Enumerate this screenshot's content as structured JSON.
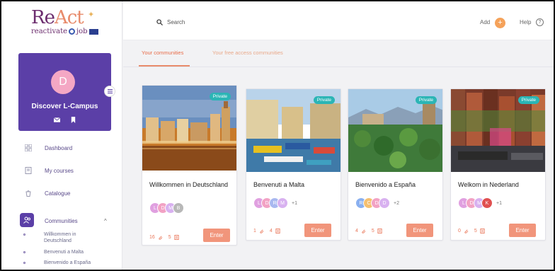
{
  "brand": {
    "logo_main": "Re",
    "logo_act": "Act",
    "logo_sub_pre": "reactivate",
    "logo_sub_post": "job"
  },
  "profile": {
    "initial": "D",
    "name": "Discover L-Campus"
  },
  "nav": [
    {
      "label": "Dashboard",
      "icon": "grid-icon"
    },
    {
      "label": "My courses",
      "icon": "book-icon"
    },
    {
      "label": "Catalogue",
      "icon": "catalogue-icon"
    },
    {
      "label": "Communities",
      "icon": "people-icon"
    }
  ],
  "communities_sub": [
    "Willkommen in Deutschland",
    "Benvenuti a Malta",
    "Bienvenido a España"
  ],
  "topbar": {
    "search_label": "Search",
    "add_label": "Add",
    "add_symbol": "+",
    "help_label": "Help",
    "help_symbol": "?"
  },
  "tabs": [
    "Your communities",
    "Your free access communities"
  ],
  "colors": {
    "accent": "#e88b6b",
    "brand": "#5b3fa7",
    "private_badge": "#2bb5b5",
    "enter_button": "#f1957b"
  },
  "cards": [
    {
      "title": "Willkommen in Deutschland",
      "badge": "Private",
      "members": [
        "L",
        "D",
        "M",
        "B"
      ],
      "more": "",
      "links": "16",
      "docs": "5",
      "enter": "Enter"
    },
    {
      "title": "Benvenuti a Malta",
      "badge": "Private",
      "members": [
        "L",
        "D",
        "R",
        "M"
      ],
      "more": "+1",
      "links": "1",
      "docs": "4",
      "enter": "Enter"
    },
    {
      "title": "Bienvenido a España",
      "badge": "Private",
      "members": [
        "R",
        "C",
        "D",
        "D"
      ],
      "more": "+2",
      "links": "4",
      "docs": "5",
      "enter": "Enter"
    },
    {
      "title": "Welkom in Nederland",
      "badge": "Private",
      "members": [
        "L",
        "D",
        "M",
        "K"
      ],
      "more": "+1",
      "links": "0",
      "docs": "5",
      "enter": "Enter"
    }
  ]
}
